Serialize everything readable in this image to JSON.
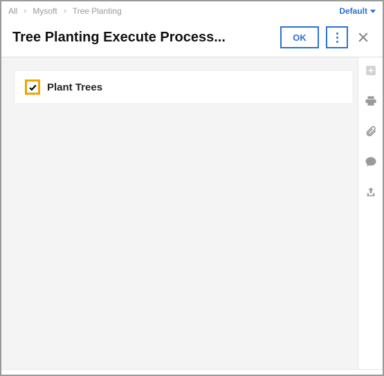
{
  "breadcrumb": {
    "items": [
      {
        "label": "All"
      },
      {
        "label": "Mysoft"
      },
      {
        "label": "Tree Planting"
      }
    ]
  },
  "layout_selector": {
    "label": "Default"
  },
  "header": {
    "title": "Tree Planting Execute Process...",
    "ok_label": "OK"
  },
  "task": {
    "label": "Plant Trees",
    "checked": true
  },
  "rail": {
    "add": "add-icon",
    "print": "print-icon",
    "attach": "attachment-icon",
    "chat": "chat-icon",
    "share": "share-icon"
  }
}
